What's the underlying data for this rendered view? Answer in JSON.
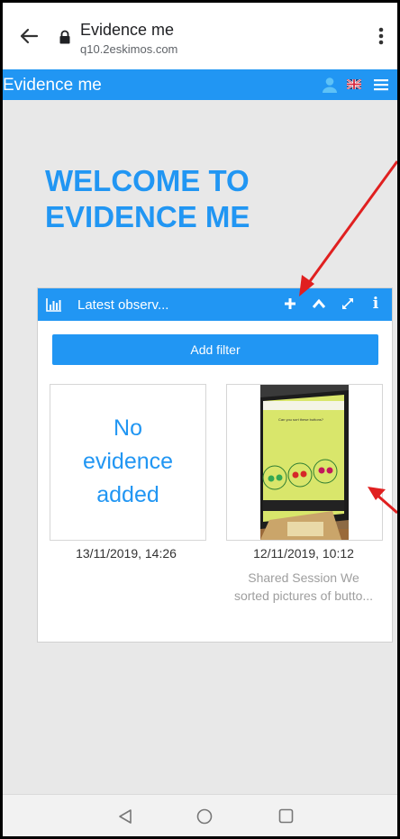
{
  "browser": {
    "tab_title": "Evidence me",
    "url": "q10.2eskimos.com"
  },
  "app": {
    "title": "Evidence me",
    "accent_color": "#2196f3"
  },
  "welcome": {
    "line1": "WELCOME TO",
    "line2": "EVIDENCE ME"
  },
  "widget": {
    "title": "Latest observ...",
    "info_label": "i",
    "add_filter_label": "Add filter",
    "cards": [
      {
        "placeholder_line1": "No",
        "placeholder_line2": "evidence",
        "placeholder_line3": "added",
        "date": "13/11/2019, 14:26",
        "description": ""
      },
      {
        "image_text": "Can you sort these buttons?",
        "date": "12/11/2019, 10:12",
        "description_line1": "Shared Session We",
        "description_line2": "sorted pictures of butto..."
      }
    ]
  },
  "icons": {
    "back": "arrow-left-icon",
    "lock": "lock-icon",
    "more": "kebab-menu-icon",
    "user": "user-icon",
    "flag": "uk-flag-icon",
    "menu": "hamburger-menu-icon",
    "chart": "bar-chart-icon",
    "add": "plus-icon",
    "collapse": "chevron-up-icon",
    "expand": "expand-icon",
    "info": "info-icon"
  }
}
